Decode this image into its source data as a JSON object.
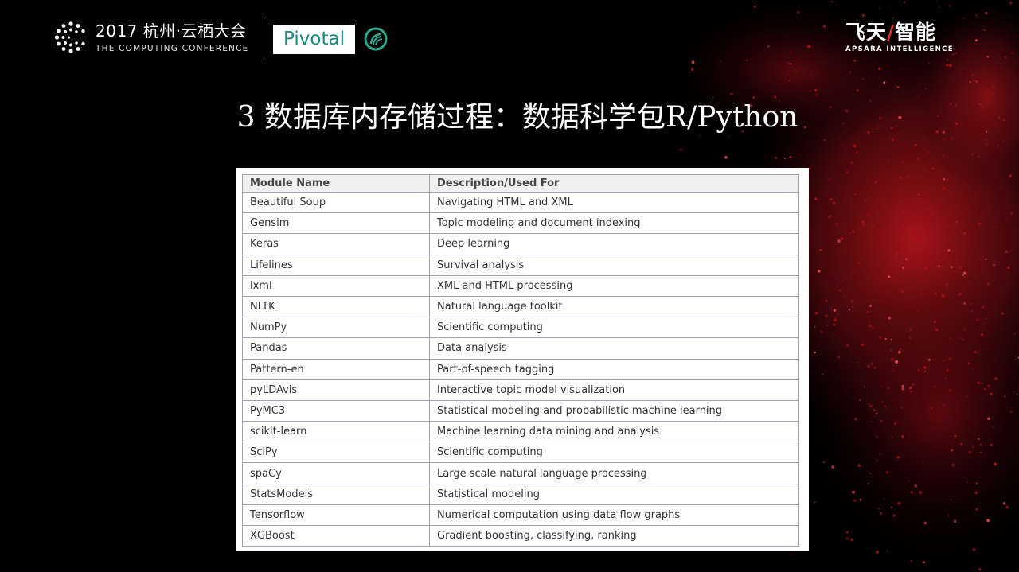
{
  "header": {
    "conference_title": "2017 杭州·云栖大会",
    "conference_subtitle": "THE COMPUTING CONFERENCE",
    "partner_logo": "Pivotal",
    "brand_cn_left": "飞天",
    "brand_cn_right": "智能",
    "brand_en": "APSARA INTELLIGENCE"
  },
  "slide": {
    "title": "3 数据库内存储过程：数据科学包R/Python"
  },
  "table": {
    "headers": [
      "Module Name",
      "Description/Used For"
    ],
    "rows": [
      [
        "Beautiful Soup",
        "Navigating HTML and XML"
      ],
      [
        "Gensim",
        "Topic modeling and document indexing"
      ],
      [
        "Keras",
        "Deep learning"
      ],
      [
        "Lifelines",
        "Survival analysis"
      ],
      [
        "lxml",
        "XML and HTML processing"
      ],
      [
        "NLTK",
        "Natural language toolkit"
      ],
      [
        "NumPy",
        "Scientific computing"
      ],
      [
        "Pandas",
        "Data analysis"
      ],
      [
        "Pattern-en",
        "Part-of-speech tagging"
      ],
      [
        "pyLDAvis",
        "Interactive topic model visualization"
      ],
      [
        "PyMC3",
        "Statistical modeling and probabilistic machine learning"
      ],
      [
        "scikit-learn",
        "Machine learning data mining and analysis"
      ],
      [
        "SciPy",
        "Scientific computing"
      ],
      [
        "spaCy",
        "Large scale natural language processing"
      ],
      [
        "StatsModels",
        "Statistical modeling"
      ],
      [
        "Tensorflow",
        "Numerical computation using data flow graphs"
      ],
      [
        "XGBoost",
        "Gradient boosting, classifying, ranking"
      ]
    ]
  },
  "colors": {
    "background": "#000000",
    "accent_red": "#c8161d",
    "pivotal_teal": "#1a8a7d"
  }
}
